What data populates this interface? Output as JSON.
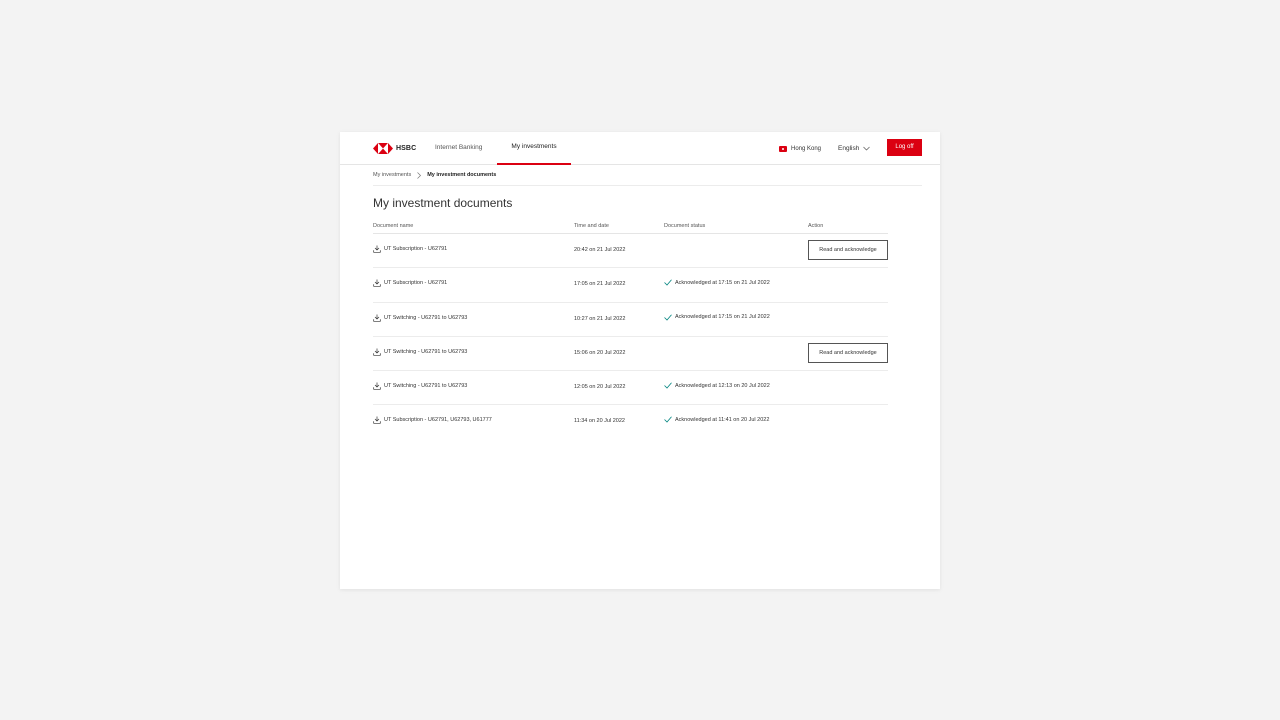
{
  "header": {
    "brand": "HSBC",
    "nav": [
      {
        "label": "Internet Banking"
      },
      {
        "label": "My investments"
      }
    ],
    "region": "Hong Kong",
    "language": "English",
    "logoff_label": "Log off"
  },
  "breadcrumb": {
    "parent": "My investments",
    "current": "My investment documents"
  },
  "page_title": "My investment documents",
  "table": {
    "headers": {
      "name": "Document name",
      "time": "Time and date",
      "status": "Document status",
      "action": "Action"
    },
    "rows": [
      {
        "name": "UT Subscription - U62791",
        "time": "20:42 on 21 Jul 2022",
        "status": "",
        "action": "Read and acknowledge"
      },
      {
        "name": "UT Subscription - U62791",
        "time": "17:05 on 21 Jul 2022",
        "status": "Acknowledged at 17:15 on 21 Jul 2022",
        "action": ""
      },
      {
        "name": "UT Switching - U62791 to U62793",
        "time": "10:27 on 21 Jul 2022",
        "status": "Acknowledged at 17:15 on 21 Jul 2022",
        "action": ""
      },
      {
        "name": "UT Switching - U62791 to U62793",
        "time": "15:06 on 20 Jul 2022",
        "status": "",
        "action": "Read and acknowledge"
      },
      {
        "name": "UT Switching - U62791 to U62793",
        "time": "12:05 on 20 Jul 2022",
        "status": "Acknowledged at 12:13 on 20 Jul 2022",
        "action": ""
      },
      {
        "name": "UT Subscription - U62791, U62793, U61777",
        "time": "11:34 on 20 Jul 2022",
        "status": "Acknowledged at 11:41 on 20 Jul 2022",
        "action": ""
      }
    ]
  },
  "colors": {
    "brand_red": "#db0011",
    "check_green": "#00847f",
    "page_bg": "#f3f3f3"
  },
  "icons": {
    "logo": "hsbc-hexagon-icon",
    "flag": "hong-kong-flag-icon",
    "chevron": "chevron-down-icon",
    "breadcrumb_sep": "chevron-right-icon",
    "download": "download-icon",
    "check": "check-icon"
  }
}
